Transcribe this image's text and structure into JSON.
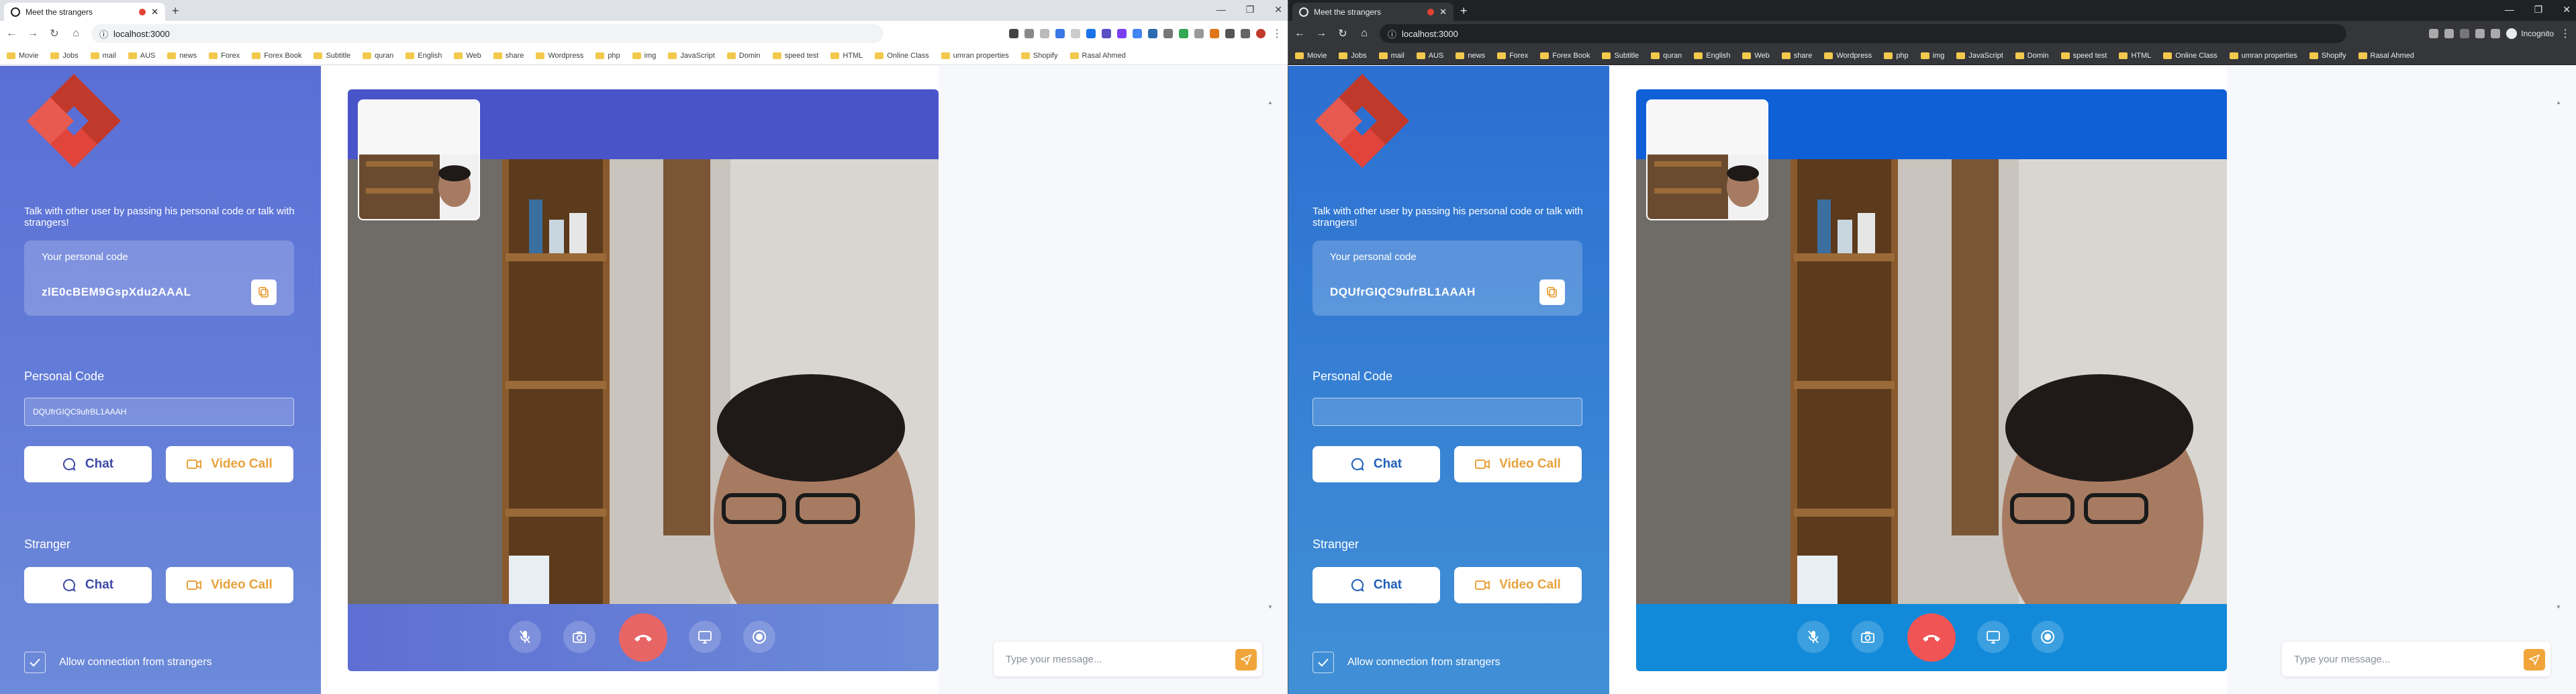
{
  "windows": [
    {
      "tab": {
        "title": "Meet the strangers"
      },
      "url": "localhost:3000",
      "bookmarks": [
        "Movie",
        "Jobs",
        "mail",
        "AUS",
        "news",
        "Forex",
        "Forex Book",
        "Subtitle",
        "quran",
        "English",
        "Web",
        "share",
        "Wordpress",
        "php",
        "img",
        "JavaScript",
        "Domin",
        "speed test",
        "HTML",
        "Online Class",
        "umran properties",
        "Shopify",
        "Rasal Ahmed"
      ],
      "sidebar": {
        "intro": "Talk with other user by passing his personal code or talk with strangers!",
        "code_caption": "Your personal code",
        "personal_code": "zlE0cBEM9GspXdu2AAAL",
        "personal_code_label": "Personal Code",
        "personal_code_input_value": "DQUfrGIQC9ufrBL1AAAH",
        "chat_label": "Chat",
        "video_call_label": "Video Call",
        "stranger_label": "Stranger",
        "allow_label": "Allow connection from strangers"
      },
      "chat": {
        "placeholder": "Type your message..."
      }
    },
    {
      "tab": {
        "title": "Meet the strangers"
      },
      "url": "localhost:3000",
      "incognito_label": "Incognito",
      "bookmarks": [
        "Movie",
        "Jobs",
        "mail",
        "AUS",
        "news",
        "Forex",
        "Forex Book",
        "Subtitle",
        "quran",
        "English",
        "Web",
        "share",
        "Wordpress",
        "php",
        "img",
        "JavaScript",
        "Domin",
        "speed test",
        "HTML",
        "Online Class",
        "umran properties",
        "Shopify",
        "Rasal Ahmed"
      ],
      "sidebar": {
        "intro": "Talk with other user by passing his personal code or talk with strangers!",
        "code_caption": "Your personal code",
        "personal_code": "DQUfrGIQC9ufrBL1AAAH",
        "personal_code_label": "Personal Code",
        "personal_code_input_value": "",
        "chat_label": "Chat",
        "video_call_label": "Video Call",
        "stranger_label": "Stranger",
        "allow_label": "Allow connection from strangers"
      },
      "chat": {
        "placeholder": "Type your message..."
      }
    }
  ],
  "colors": {
    "light_sidebar": "#5a6fd6",
    "dark_sidebar": "#2b6fd1",
    "accent_orange": "#e8a23c",
    "hangup_red": "#f05454",
    "logo_red": "#e0443a"
  }
}
